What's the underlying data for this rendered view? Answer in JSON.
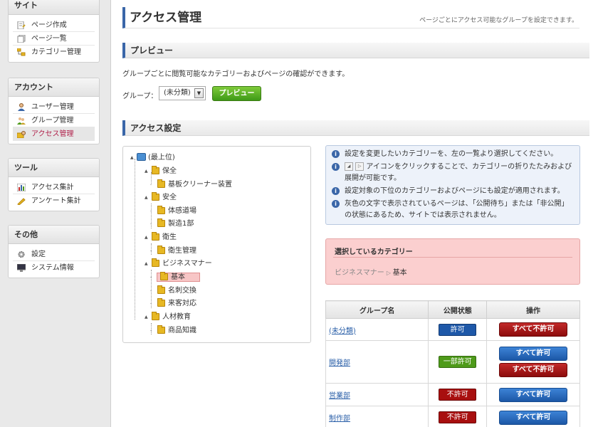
{
  "sidebar": {
    "sections": [
      {
        "title": "サイト",
        "items": [
          {
            "label": "ページ作成",
            "icon": "page-create-icon"
          },
          {
            "label": "ページ一覧",
            "icon": "page-list-icon"
          },
          {
            "label": "カテゴリー管理",
            "icon": "category-icon"
          }
        ]
      },
      {
        "title": "アカウント",
        "items": [
          {
            "label": "ユーザー管理",
            "icon": "user-icon"
          },
          {
            "label": "グループ管理",
            "icon": "group-icon"
          },
          {
            "label": "アクセス管理",
            "icon": "access-icon",
            "active": true
          }
        ]
      },
      {
        "title": "ツール",
        "items": [
          {
            "label": "アクセス集計",
            "icon": "chart-icon"
          },
          {
            "label": "アンケート集計",
            "icon": "survey-icon"
          }
        ]
      },
      {
        "title": "その他",
        "items": [
          {
            "label": "設定",
            "icon": "gear-icon"
          },
          {
            "label": "システム情報",
            "icon": "monitor-icon"
          }
        ]
      }
    ]
  },
  "page": {
    "title": "アクセス管理",
    "description": "ページごとにアクセス可能なグループを設定できます。"
  },
  "preview": {
    "heading": "プレビュー",
    "description": "グループごとに閲覧可能なカテゴリーおよびページの確認ができます。",
    "group_label": "グループ：",
    "group_value": "(未分類)",
    "button": "プレビュー"
  },
  "access": {
    "heading": "アクセス設定",
    "tree": [
      {
        "label": "(最上位)",
        "level": 0,
        "type": "root"
      },
      {
        "label": "保全",
        "level": 1
      },
      {
        "label": "基板クリーナー装置",
        "level": 2
      },
      {
        "label": "安全",
        "level": 1
      },
      {
        "label": "体感道場",
        "level": 2
      },
      {
        "label": "製造1部",
        "level": 2
      },
      {
        "label": "衛生",
        "level": 1
      },
      {
        "label": "衛生管理",
        "level": 2
      },
      {
        "label": "ビジネスマナー",
        "level": 1
      },
      {
        "label": "基本",
        "level": 2,
        "selected": true
      },
      {
        "label": "名刺交換",
        "level": 2
      },
      {
        "label": "来客対応",
        "level": 2
      },
      {
        "label": "人材教育",
        "level": 1
      },
      {
        "label": "商品知識",
        "level": 2
      }
    ],
    "info": [
      {
        "text": "設定を変更したいカテゴリーを、左の一覧より選択してください。"
      },
      {
        "pre": "",
        "post": " アイコンをクリックすることで、カテゴリーの折りたたみおよび展開が可能です。"
      },
      {
        "text": "設定対象の下位のカテゴリーおよびページにも設定が適用されます。"
      },
      {
        "text": "灰色の文字で表示されているページは、「公開待ち」または「非公開」の状態にあるため、サイトでは表示されません。"
      }
    ],
    "selected": {
      "title": "選択しているカテゴリー",
      "parent": "ビジネスマナー",
      "current": "基本"
    },
    "table": {
      "headers": [
        "グループ名",
        "公開状態",
        "操作"
      ],
      "rows": [
        {
          "name": "(未分類)",
          "status": "許可",
          "status_color": "#1e58a8",
          "actions": [
            "すべて不許可"
          ]
        },
        {
          "name": "開発部",
          "status": "一部許可",
          "status_color": "#4e9a1a",
          "actions": [
            "すべて許可",
            "すべて不許可"
          ]
        },
        {
          "name": "営業部",
          "status": "不許可",
          "status_color": "#a80f0f",
          "actions": [
            "すべて許可"
          ]
        },
        {
          "name": "制作部",
          "status": "不許可",
          "status_color": "#a80f0f",
          "actions": [
            "すべて許可"
          ]
        }
      ]
    }
  }
}
